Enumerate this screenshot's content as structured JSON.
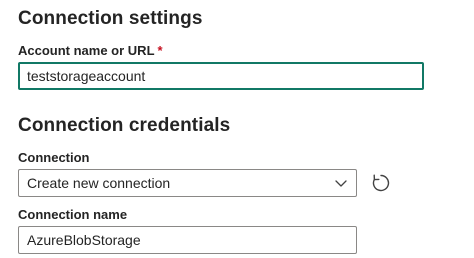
{
  "connection_settings": {
    "heading": "Connection settings",
    "account": {
      "label": "Account name or URL",
      "required_mark": "*",
      "value": "teststorageaccount"
    }
  },
  "connection_credentials": {
    "heading": "Connection credentials",
    "connection": {
      "label": "Connection",
      "selected": "Create new connection",
      "dropdown_icon": "chevron-down-icon",
      "refresh_icon": "refresh-icon"
    },
    "connection_name": {
      "label": "Connection name",
      "value": "AzureBlobStorage"
    }
  },
  "colors": {
    "focus_border": "#117865",
    "required": "#c50f1f",
    "text": "#242424",
    "border": "#8a8886"
  }
}
